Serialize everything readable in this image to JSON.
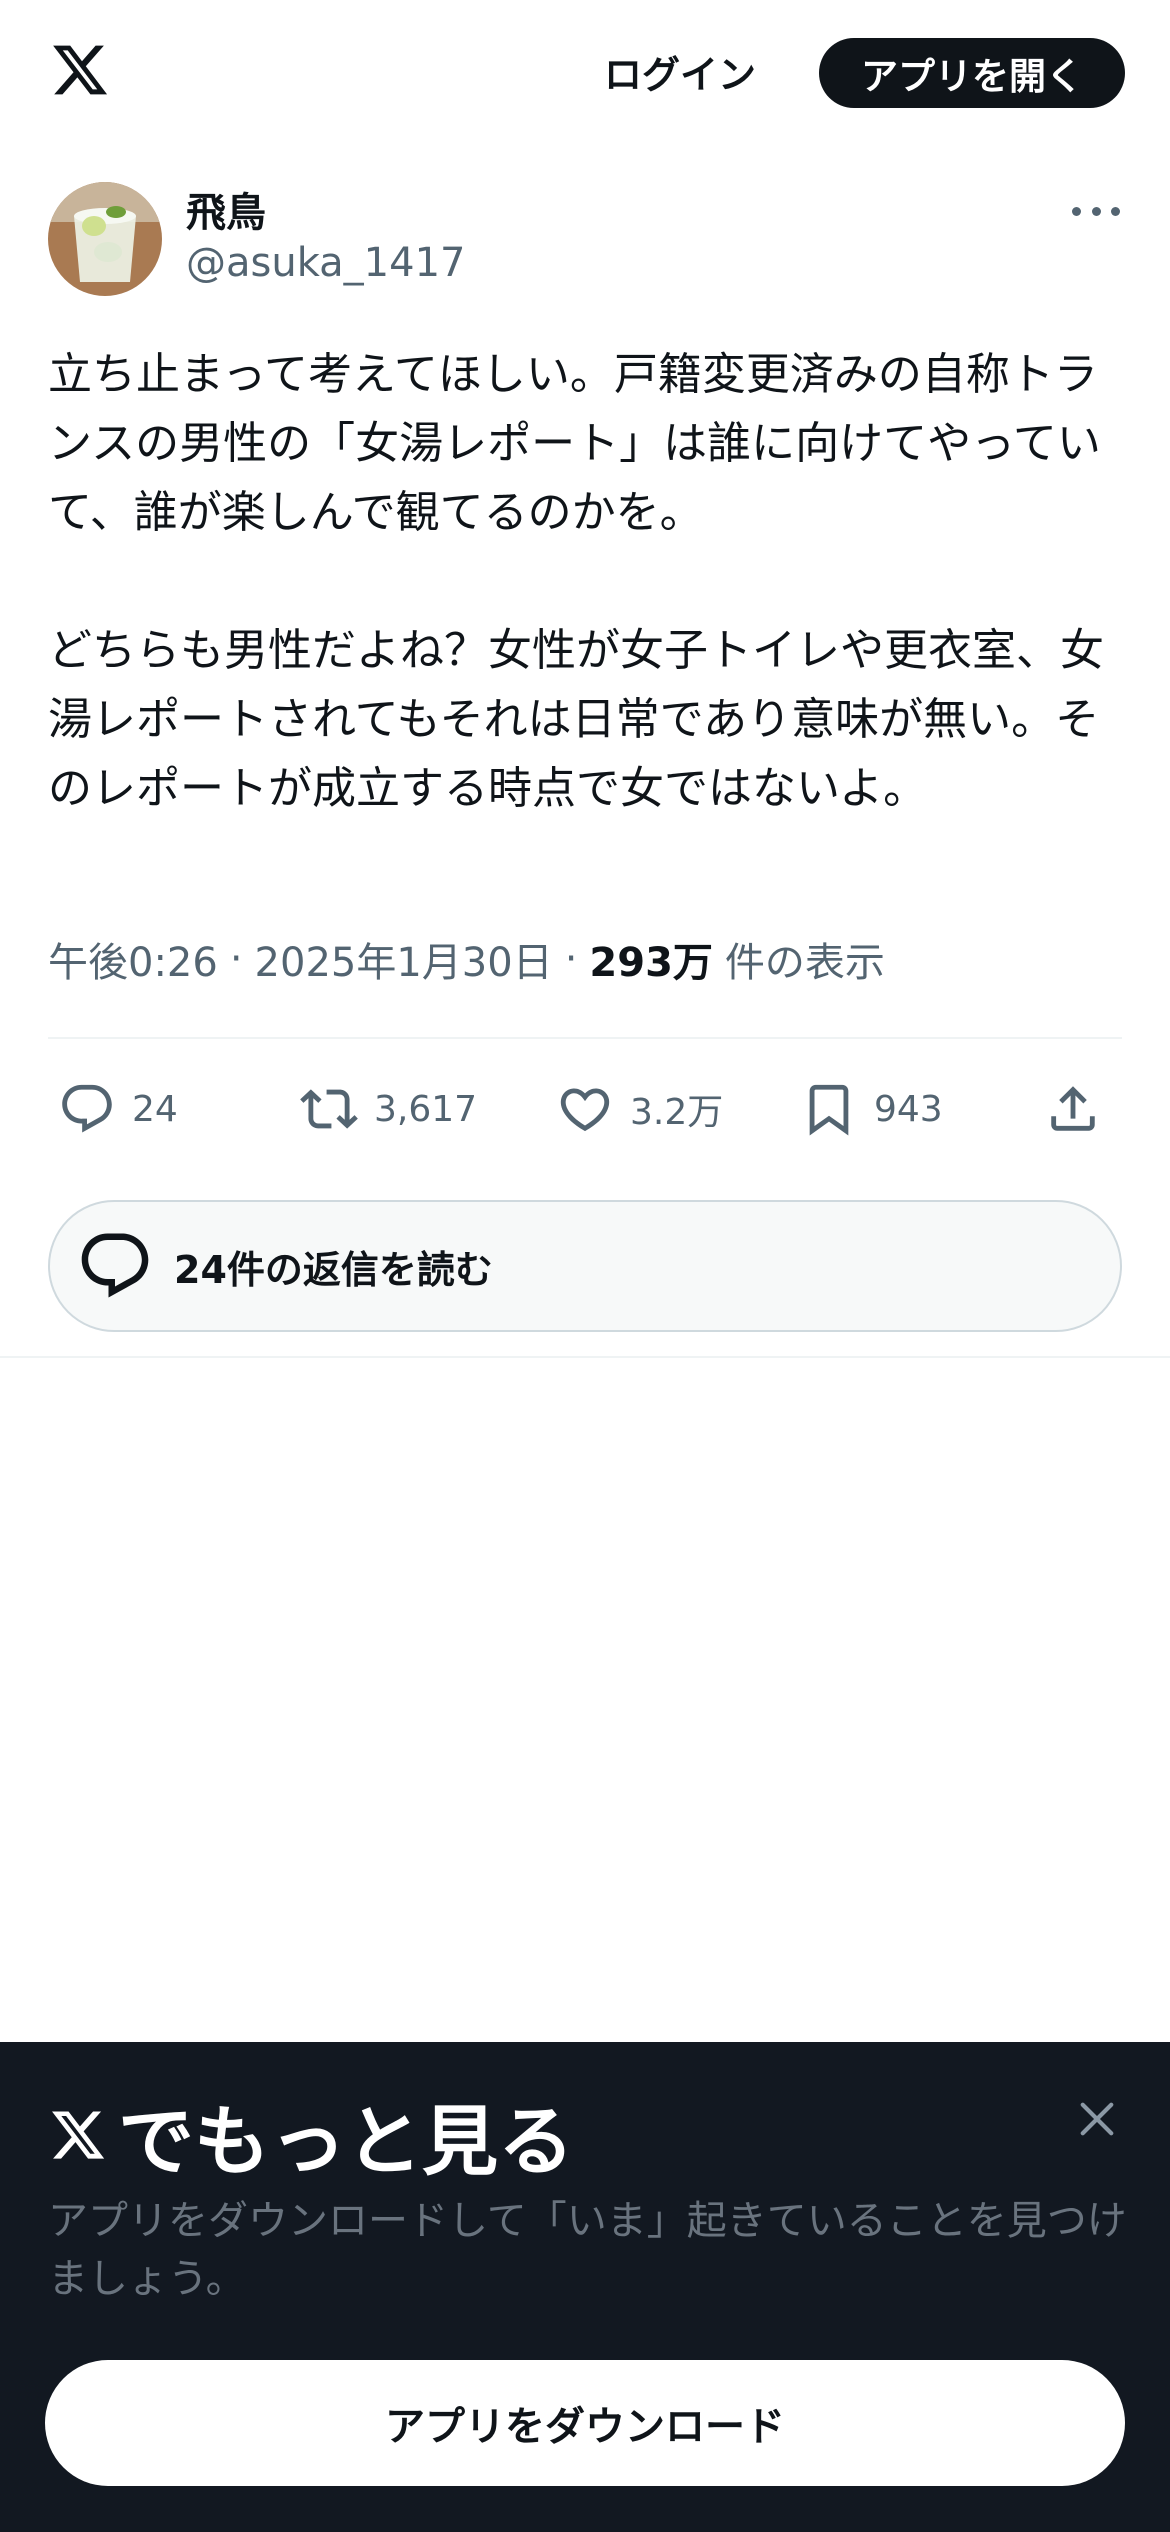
{
  "header": {
    "logo_icon": "x-logo-icon",
    "login_label": "ログイン",
    "open_app_label": "アプリを開く"
  },
  "tweet": {
    "author_name": "飛鳥",
    "author_handle": "@asuka_1417",
    "avatar_icon": "avatar-drink-photo",
    "more_icon": "more-icon",
    "text": "立ち止まって考えてほしい。戸籍変更済みの自称トランスの男性の「女湯レポート」は誰に向けてやっていて、誰が楽しんで観てるのかを。\n\nどちらも男性だよね？女性が女子トイレや更衣室、女湯レポートされてもそれは日常であり意味が無い。そのレポートが成立する時点で女ではないよ。",
    "time": "午後0:26",
    "separator": "·",
    "date": "2025年1月30日",
    "views_count": "293万",
    "views_label": "件の表示"
  },
  "actions": {
    "reply_count": "24",
    "retweet_count": "3,617",
    "like_count": "3.2万",
    "bookmark_count": "943",
    "icons": [
      "reply-icon",
      "retweet-icon",
      "like-icon",
      "bookmark-icon",
      "share-icon"
    ]
  },
  "replies": {
    "label": "24件の返信を読む"
  },
  "banner": {
    "title": "でもっと見る",
    "subtitle": "アプリをダウンロードして「いま」起きていることを見つけましょう。",
    "download_label": "アプリをダウンロード"
  },
  "colors": {
    "text_primary": "#0f1419",
    "text_secondary": "#536471",
    "banner_bg": "#121821",
    "divider": "#eff3f4"
  }
}
